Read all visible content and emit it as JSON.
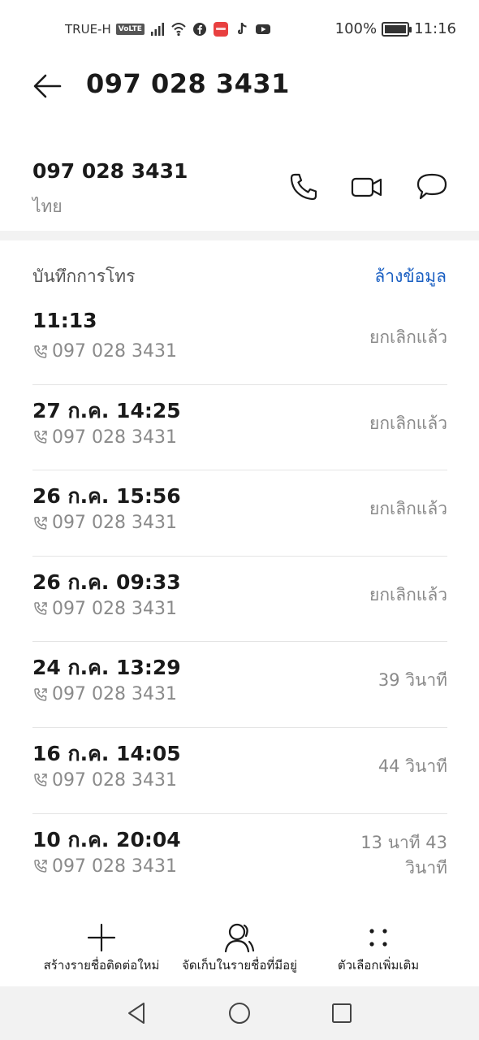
{
  "status_bar": {
    "carrier": "TRUE-H",
    "volte": "VoLTE",
    "battery": "100%",
    "time": "11:16"
  },
  "header": {
    "title": "097 028 3431"
  },
  "contact": {
    "number": "097 028 3431",
    "location": "ไทย"
  },
  "call_log": {
    "title": "บันทึกการโทร",
    "clear_label": "ล้างข้อมูล",
    "entries": [
      {
        "time": "11:13",
        "number": "097 028 3431",
        "status": "ยกเลิกแล้ว"
      },
      {
        "time": "27 ก.ค. 14:25",
        "number": "097 028 3431",
        "status": "ยกเลิกแล้ว"
      },
      {
        "time": "26 ก.ค. 15:56",
        "number": "097 028 3431",
        "status": "ยกเลิกแล้ว"
      },
      {
        "time": "26 ก.ค. 09:33",
        "number": "097 028 3431",
        "status": "ยกเลิกแล้ว"
      },
      {
        "time": "24 ก.ค. 13:29",
        "number": "097 028 3431",
        "status": "39 วินาที"
      },
      {
        "time": "16 ก.ค. 14:05",
        "number": "097 028 3431",
        "status": "44 วินาที"
      },
      {
        "time": "10 ก.ค. 20:04",
        "number": "097 028 3431",
        "status_line1": "13 นาที 43",
        "status_line2": "วินาที"
      }
    ]
  },
  "toolbar": {
    "new_contact_label": "สร้างรายชื่อติดต่อใหม่",
    "save_existing_label": "จัดเก็บในรายชื่อที่มีอยู่",
    "more_label": "ตัวเลือกเพิ่มเติม"
  },
  "colors": {
    "accent": "#1a5fc2",
    "secondary_text": "#8a8a8a",
    "navbar_bg": "#f2f2f2"
  }
}
